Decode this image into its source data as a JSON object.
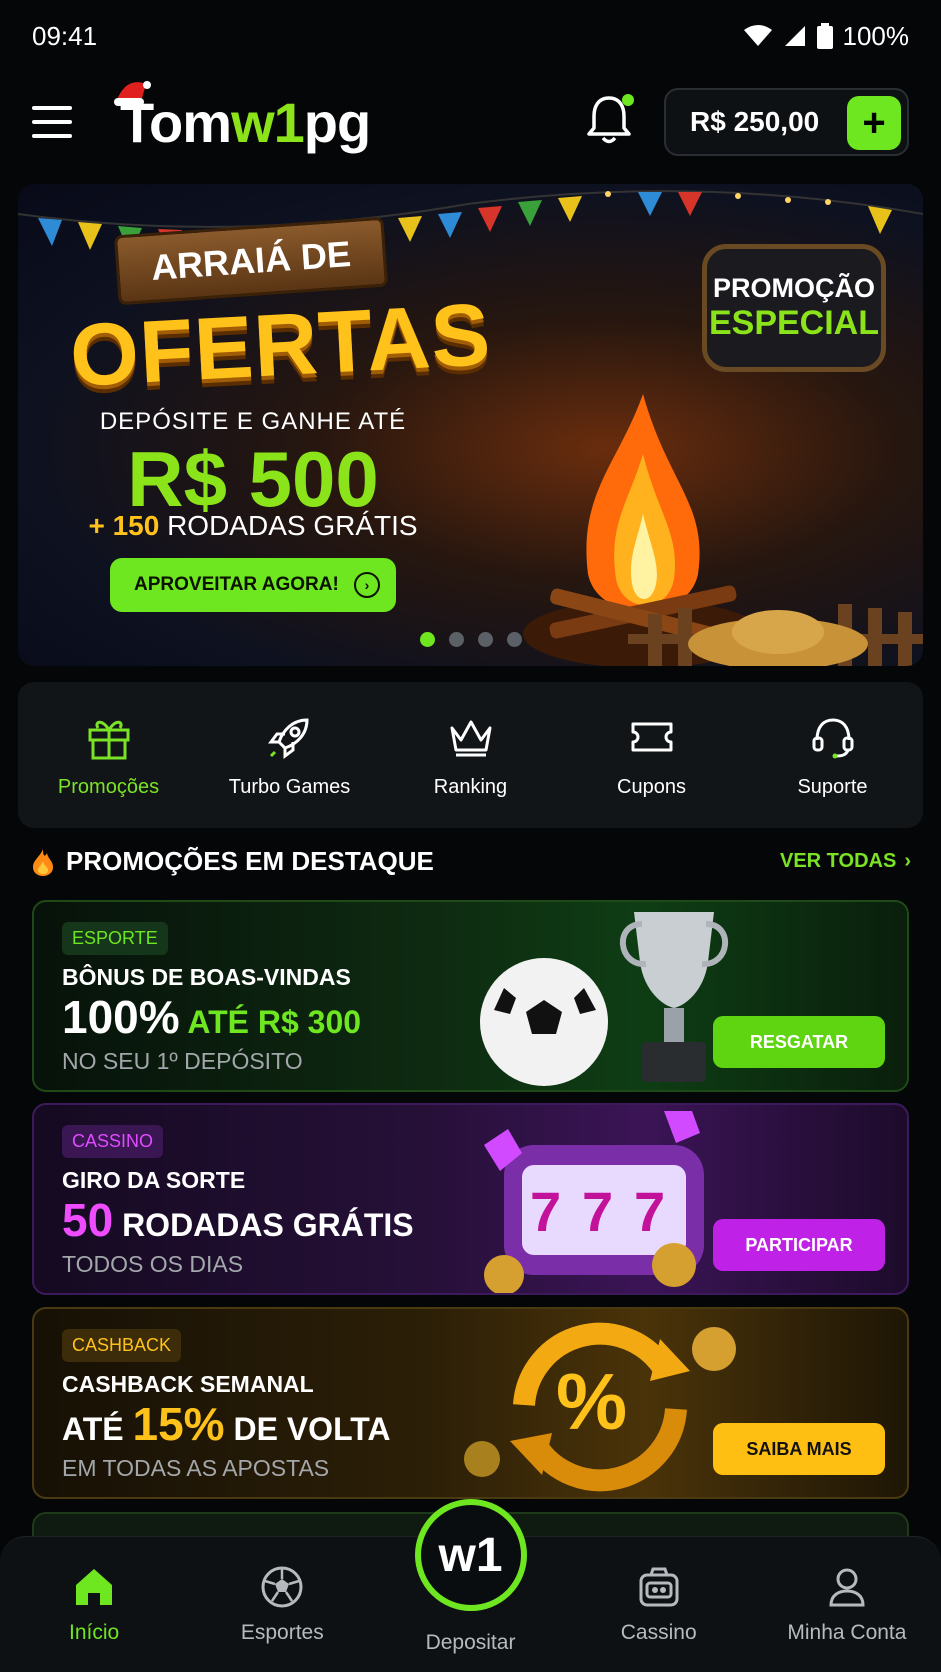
{
  "status": {
    "time": "09:41",
    "battery": "100%"
  },
  "header": {
    "logo_part1": "Tom",
    "logo_part2": "w1",
    "logo_part3": "pg",
    "balance": "R$ 250,00"
  },
  "banner": {
    "line1": "ARRAIÁ DE",
    "line2": "OFERTAS",
    "subtitle": "DEPÓSITE E GANHE ATÉ",
    "amount": "R$ 500",
    "extra_plus": "+ 150",
    "extra_text": " RODADAS GRÁTIS",
    "cta": "APROVEITAR AGORA!",
    "badge_line1": "PROMOÇÃO",
    "badge_line2": "ESPECIAL",
    "slides": 4,
    "active_slide": 1
  },
  "quick_links": [
    {
      "label": "Promoções",
      "icon": "gift-icon"
    },
    {
      "label": "Turbo Games",
      "icon": "rocket-icon"
    },
    {
      "label": "Ranking",
      "icon": "crown-icon"
    },
    {
      "label": "Cupons",
      "icon": "ticket-icon"
    },
    {
      "label": "Suporte",
      "icon": "headset-icon"
    }
  ],
  "section": {
    "title": "PROMOÇÕES EM DESTAQUE",
    "see_all": "VER TODAS"
  },
  "promos": [
    {
      "tag": "ESPORTE",
      "title": "BÔNUS DE BOAS-VINDAS",
      "main_a": "100%",
      "main_b": " ATÉ R$ 300",
      "sub": "NO SEU 1º DEPÓSITO",
      "button": "RESGATAR"
    },
    {
      "tag": "CASSINO",
      "title": "GIRO DA SORTE",
      "main_a": "50",
      "main_b": " RODADAS GRÁTIS",
      "sub": "TODOS OS DIAS",
      "button": "PARTICIPAR"
    },
    {
      "tag": "CASHBACK",
      "title": "CASHBACK SEMANAL",
      "main_pre": "ATÉ ",
      "main_a": "15%",
      "main_b": " DE VOLTA",
      "sub": "EM TODAS AS APOSTAS",
      "button": "SAIBA MAIS"
    }
  ],
  "bottom_nav": [
    {
      "label": "Início",
      "icon": "home-icon"
    },
    {
      "label": "Esportes",
      "icon": "soccer-ball-icon"
    },
    {
      "label": "Depositar",
      "icon": "w1-logo-icon",
      "center_text": "w1"
    },
    {
      "label": "Cassino",
      "icon": "slot-machine-icon"
    },
    {
      "label": "Minha Conta",
      "icon": "user-icon"
    }
  ],
  "colors": {
    "accent": "#6ee620",
    "casino": "#c021e6",
    "cashback": "#ffbf12",
    "background": "#050607"
  }
}
